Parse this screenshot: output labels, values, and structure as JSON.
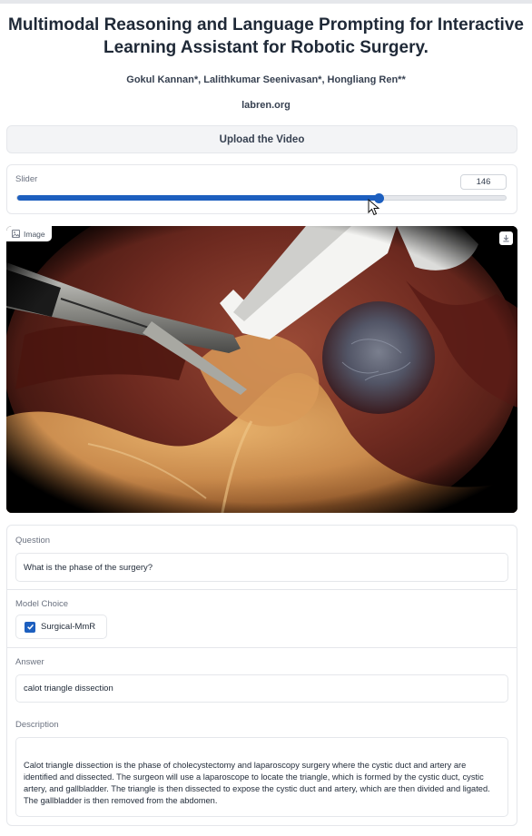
{
  "header": {
    "title": "Multimodal Reasoning and Language Prompting for Interactive Learning Assistant for Robotic Surgery.",
    "authors": "Gokul Kannan*, Lalithkumar Seenivasan*, Hongliang Ren**",
    "site": "labren.org"
  },
  "upload": {
    "label": "Upload the Video"
  },
  "slider": {
    "label": "Slider",
    "value": "146",
    "fraction": 0.74
  },
  "image": {
    "label": "Image",
    "icon": "image-icon",
    "download_icon": "download-icon"
  },
  "form": {
    "question_label": "Question",
    "question_value": "What is the phase of the surgery?",
    "model_label": "Model Choice",
    "model_option": "Surgical-MmR",
    "model_checked": true,
    "answer_label": "Answer",
    "answer_value": "calot triangle dissection",
    "description_label": "Description",
    "description_value": "Calot triangle dissection is the phase of cholecystectomy and laparoscopy surgery where the cystic duct and artery are identified and dissected. The surgeon will use a laparoscope to locate the triangle, which is formed by the cystic duct, cystic artery, and gallbladder. The triangle is then dissected to expose the cystic duct and artery, which are then divided and ligated. The gallbladder is then removed from the abdomen."
  },
  "colors": {
    "accent": "#1d5fbf",
    "border": "#e5e7eb",
    "label": "#6b7280"
  }
}
